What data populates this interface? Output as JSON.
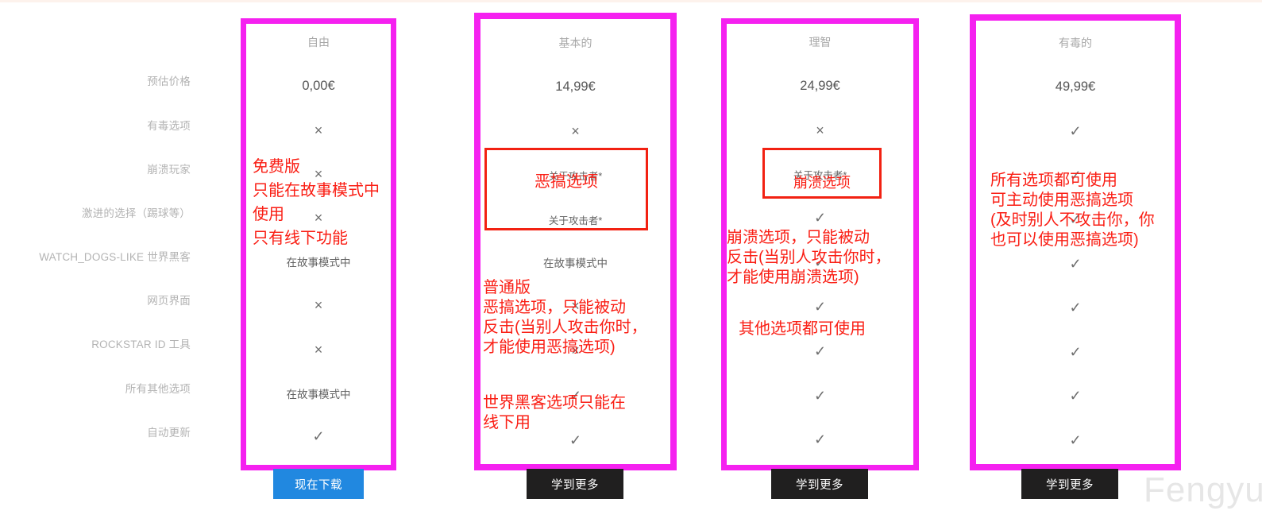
{
  "theme": {
    "highlight_border": "#f521f0",
    "annotation_red": "#fa1e14",
    "primary_button_bg": "#2188e0",
    "secondary_button_bg": "#201f1f",
    "label_gray": "#b3b3b3",
    "cell_gray": "#6e6e6e"
  },
  "watermark": "Fengyu",
  "rows": [
    {
      "label": "预估价格"
    },
    {
      "label": "有毒选项"
    },
    {
      "label": "崩溃玩家"
    },
    {
      "label": "激进的选择（踢球等）"
    },
    {
      "label": "WATCH_DOGS-LIKE 世界黑客"
    },
    {
      "label": "网页界面"
    },
    {
      "label": "ROCKSTAR ID 工具"
    },
    {
      "label": "所有其他选项"
    },
    {
      "label": "自动更新"
    }
  ],
  "plans": [
    {
      "id": "free",
      "title": "自由",
      "price": "0,00€",
      "cells": [
        "×",
        "×",
        "×",
        "在故事模式中",
        "×",
        "×",
        "在故事模式中",
        "✓"
      ],
      "cta": {
        "label": "现在下载",
        "style": "primary"
      }
    },
    {
      "id": "basic",
      "title": "基本的",
      "price": "14,99€",
      "cells": [
        "×",
        "关于攻击者*",
        "关于攻击者*",
        "在故事模式中",
        "×",
        "×",
        "✓",
        "✓"
      ],
      "cta": {
        "label": "学到更多",
        "style": "secondary"
      }
    },
    {
      "id": "sane",
      "title": "理智",
      "price": "24,99€",
      "cells": [
        "×",
        "关于攻击者*",
        "✓",
        "✓",
        "✓",
        "✓",
        "✓",
        "✓"
      ],
      "cta": {
        "label": "学到更多",
        "style": "secondary"
      }
    },
    {
      "id": "toxic",
      "title": "有毒的",
      "price": "49,99€",
      "cells": [
        "✓",
        "✓",
        "✓",
        "✓",
        "✓",
        "✓",
        "✓",
        "✓"
      ],
      "cta": {
        "label": "学到更多",
        "style": "secondary"
      }
    }
  ],
  "annotations": {
    "free": {
      "line1": "免费版",
      "line2": "只能在故事模式中",
      "line3": "使用",
      "line4": "只有线下功能"
    },
    "basic": {
      "box_label": "恶搞选项",
      "note": "普通版\n恶搞选项，只能被动\n反击(当别人攻击你时，\n才能使用恶搞选项)",
      "note2": "世界黑客选项只能在\n线下用"
    },
    "sane": {
      "box_label": "崩溃选项",
      "note": "崩溃选项，只能被动\n反击(当别人攻击你时，\n才能使用崩溃选项)",
      "note2": "其他选项都可使用"
    },
    "toxic": {
      "note": "所有选项都可使用\n可主动使用恶搞选项\n(及时别人不攻击你，你\n也可以使用恶搞选项)"
    }
  }
}
